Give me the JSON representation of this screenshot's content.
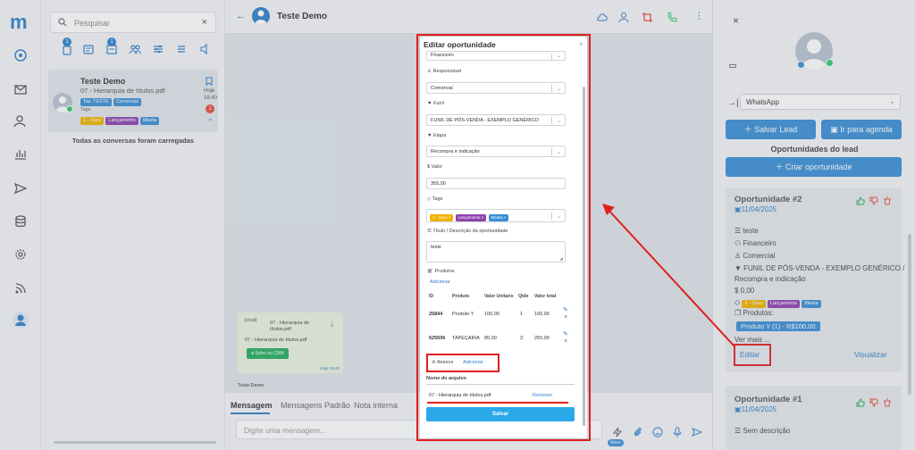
{
  "app": {
    "logo": "m"
  },
  "conversation_list": {
    "search_placeholder": "Pesquisar",
    "filter_badges": [
      "1",
      "1"
    ],
    "card": {
      "name": "Teste Demo",
      "last_message": "07 - Hierarquia de títulos.pdf",
      "tags": [
        "Tav. TESTE",
        "Comercial"
      ],
      "tags_label": "Tags",
      "tag_list": [
        "1 - Ouro",
        "Lançamento",
        "Meeta"
      ],
      "time_day": "Hoje",
      "time": "18:40",
      "unread": "1"
    },
    "loaded_msg": "Todas as conversas foram carregadas"
  },
  "chat": {
    "contact_name": "Teste Demo",
    "attachment": {
      "thumb_alt": "[chat]",
      "title": "07 - Hierarquia de títulos.pdf",
      "subtitle": "07 - Hierarquia de títulos.pdf",
      "crm_label": "Salvo no CRM",
      "time": "Hoje 18:40"
    },
    "sender_label": "Teste Demo",
    "tabs": [
      "Mensagem",
      "Mensagens Padrão",
      "Nota interna"
    ],
    "input_placeholder": "Digite uma mensagem...",
    "novo_badge": "Novo"
  },
  "modal": {
    "title": "Editar oportunidade",
    "close": "×",
    "top_select_value": "Financeiro",
    "fields": {
      "responsavel_label": "Responsável",
      "responsavel_value": "Comercial",
      "funil_label": "Funil",
      "funil_value": "FUNIL DE PÓS-VENDA - EXEMPLO GENÉRICO",
      "etapa_label": "Etapa",
      "etapa_value": "Recompra e indicação",
      "valor_label": "Valor",
      "valor_value": "355,00",
      "tags_label": "Tags",
      "tags": [
        "1 - Ouro",
        "Lançamento",
        "Meeta"
      ],
      "titulo_label": "Título / Descrição da oportunidade",
      "titulo_value": "teste",
      "produtos_label": "Produtos",
      "adicionar": "Adicionar"
    },
    "products_table": {
      "headers": [
        "ID",
        "Produto",
        "Valor Unitario",
        "Qtde",
        "Valor total"
      ],
      "rows": [
        [
          "25844",
          "Produto Y",
          "100,00",
          "1",
          "100,00"
        ],
        [
          "625506",
          "TAPEÇARIA",
          "85,00",
          "3",
          "255,00"
        ]
      ]
    },
    "anexos": {
      "label": "Anexos",
      "add": "Adicionar",
      "file_header": "Nome do arquivo",
      "file_name": "07 - Hierarquia de títulos.pdf",
      "remove": "Remover"
    },
    "save": "Salvar"
  },
  "right_panel": {
    "close": "×",
    "channel": "WhatsApp",
    "save_lead": "Salvar Lead",
    "agenda": "Ir para agenda",
    "opps_title": "Oportunidades do lead",
    "create_opp": "Criar oportunidade",
    "opp2": {
      "title": "Oportunidade #2",
      "date": "11/04/2025",
      "description": "teste",
      "group": "Financeiro",
      "responsible": "Comercial",
      "funnel": "FUNIL DE PÓS-VENDA - EXEMPLO GENÉRICO /",
      "stage": "Recompra e indicação",
      "value": "0,00",
      "tags": [
        "1 - Ouro",
        "Lançamento",
        "Meeta"
      ],
      "products_label": "Produtos:",
      "product_chip": "Produto Y (1) - R$100,00",
      "more": "Ver mais ...",
      "edit": "Editar",
      "view": "Visualizar"
    },
    "opp1": {
      "title": "Oportunidade #1",
      "date": "11/04/2025",
      "description": "Sem descrição"
    }
  },
  "colors": {
    "accent": "#3a8fd6",
    "annotation": "#e02020",
    "tag_gold": "#f0b400",
    "tag_purple": "#8e44ad",
    "tag_blue": "#3a8fd6",
    "save_button": "#29a9e8"
  }
}
